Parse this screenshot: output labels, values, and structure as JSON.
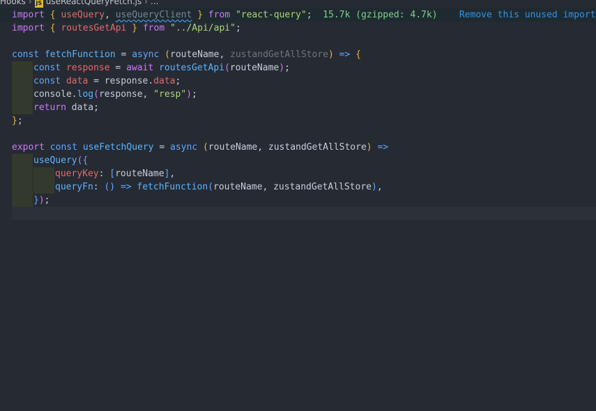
{
  "breadcrumb": {
    "folder": "Hooks",
    "file_badge": "JS",
    "file": "useReactQueryFetch.js",
    "tail": "..."
  },
  "code": {
    "l1": {
      "kw_import": "import",
      "open": "{",
      "id1": "useQuery",
      "comma": ",",
      "id2": "useQueryClient",
      "close": "}",
      "kw_from": "from",
      "module": "\"react-query\"",
      "semi": ";",
      "size_hint": "15.7k (gzipped: 4.7k)",
      "lens": "Remove this unused import o"
    },
    "l2": {
      "kw_import": "import",
      "open": "{",
      "id": "routesGetApi",
      "close": "}",
      "kw_from": "from",
      "module": "\"../Api/api\"",
      "semi": ";"
    },
    "l4": {
      "kw_const": "const",
      "name": "fetchFunction",
      "eq": "=",
      "kw_async": "async",
      "popen": "(",
      "p1": "routeName",
      "comma": ",",
      "p2": "zustandGetAllStore",
      "pclose": ")",
      "arrow": "=>",
      "brace": "{"
    },
    "l5": {
      "kw_const": "const",
      "name": "response",
      "eq": "=",
      "kw_await": "await",
      "fn": "routesGetApi",
      "popen": "(",
      "arg": "routeName",
      "pclose": ")",
      "semi": ";"
    },
    "l6": {
      "kw_const": "const",
      "name": "data",
      "rest": "= response.",
      "prop": "data",
      "semi": ";"
    },
    "l7": {
      "obj": "console.",
      "fn": "log",
      "popen": "(",
      "arg": "response, ",
      "str": "\"resp\"",
      "pclose": ")",
      "semi": ";"
    },
    "l8": {
      "kw_return": "return",
      "rest": "data;"
    },
    "l9": {
      "brace": "}",
      "semi": ";"
    },
    "l11": {
      "kw_export": "export",
      "kw_const": "const",
      "name": "useFetchQuery",
      "eq": "=",
      "kw_async": "async",
      "popen": "(",
      "params": "routeName, zustandGetAllStore",
      "pclose": ")",
      "arrow": "=>"
    },
    "l12": {
      "fn": "useQuery",
      "popen": "(",
      "brace": "{"
    },
    "l13": {
      "key": "queryKey",
      "colon": ":",
      "bopen": "[",
      "val": "routeName",
      "bclose": "]",
      "comma": ","
    },
    "l14": {
      "key": "queryFn",
      "colon": ":",
      "parens": "()",
      "arrow": "=>",
      "fn": "fetchFunction",
      "popen": "(",
      "args": "routeName, zustandGetAllStore",
      "pclose": ")",
      "comma": ","
    },
    "l15": {
      "brace": "}",
      "pclose": ")",
      "semi": ";"
    }
  },
  "colors": {
    "background": "#262a33",
    "keyword": "#5fa8ff",
    "control_keyword": "#c97cf5",
    "function": "#5bb5ff",
    "variable": "#e26b6b",
    "string": "#a7d875",
    "bracket": "#e3b74a"
  }
}
